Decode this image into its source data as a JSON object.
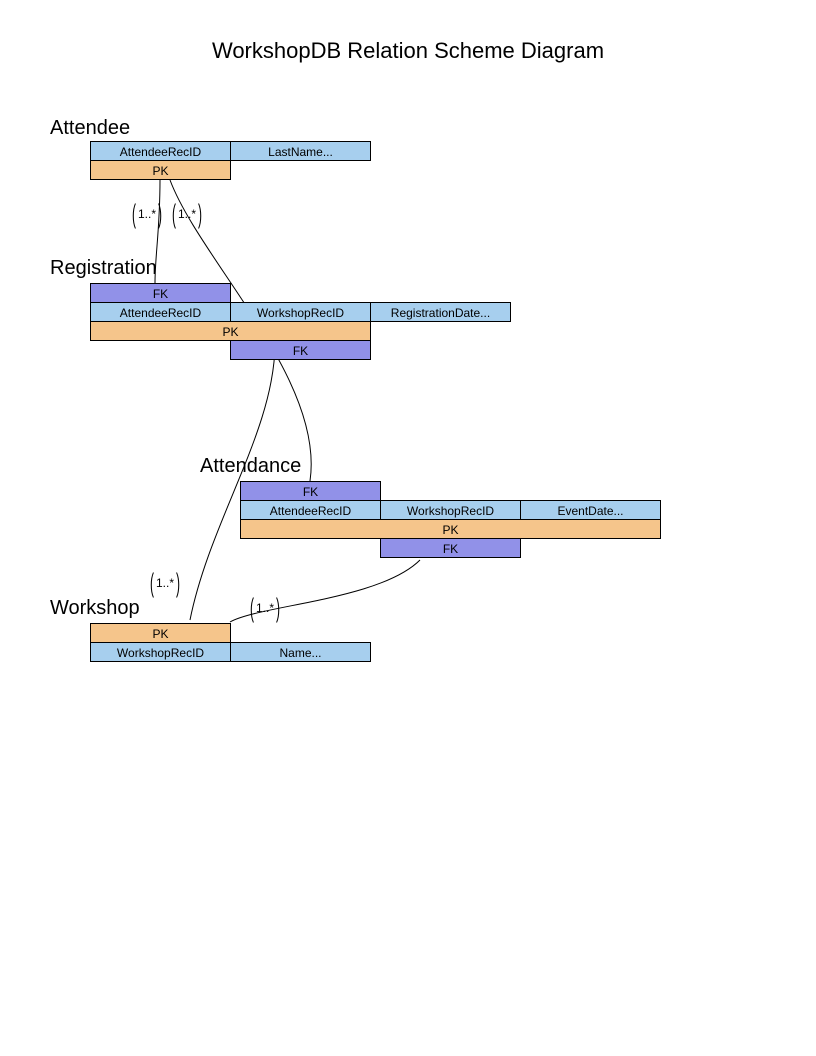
{
  "title": "WorkshopDB Relation Scheme Diagram",
  "labels": {
    "pk": "PK",
    "fk": "FK"
  },
  "cardinality": {
    "one_many": "1..*"
  },
  "entities": {
    "attendee": {
      "name": "Attendee",
      "cols": [
        "AttendeeRecID",
        "LastName..."
      ]
    },
    "registration": {
      "name": "Registration",
      "cols": [
        "AttendeeRecID",
        "WorkshopRecID",
        "RegistrationDate..."
      ]
    },
    "attendance": {
      "name": "Attendance",
      "cols": [
        "AttendeeRecID",
        "WorkshopRecID",
        "EventDate..."
      ]
    },
    "workshop": {
      "name": "Workshop",
      "cols": [
        "WorkshopRecID",
        "Name..."
      ]
    }
  }
}
